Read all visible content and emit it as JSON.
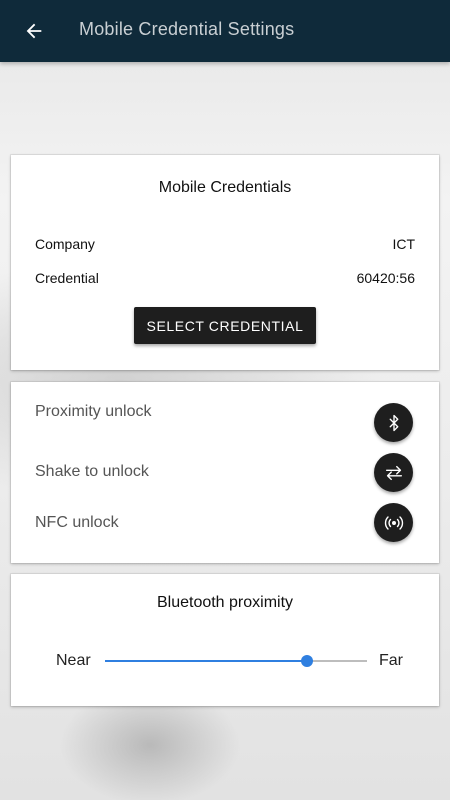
{
  "appbar": {
    "title": "Mobile Credential Settings",
    "back_icon": "arrow-left-icon"
  },
  "credentials": {
    "title": "Mobile Credentials",
    "rows": [
      {
        "label": "Company",
        "value": "ICT"
      },
      {
        "label": "Credential",
        "value": "60420:56"
      }
    ],
    "select_label": "SELECT CREDENTIAL"
  },
  "unlock_options": [
    {
      "label": "Proximity unlock",
      "icon": "bluetooth-icon"
    },
    {
      "label": "Shake to unlock",
      "icon": "swap-arrows-icon"
    },
    {
      "label": "NFC unlock",
      "icon": "nfc-icon"
    }
  ],
  "proximity": {
    "title": "Bluetooth proximity",
    "min_label": "Near",
    "max_label": "Far",
    "value_fraction": 0.77
  },
  "colors": {
    "appbar": "#0f2a3a",
    "accent": "#2f7fe0",
    "button": "#1e1e1e"
  }
}
